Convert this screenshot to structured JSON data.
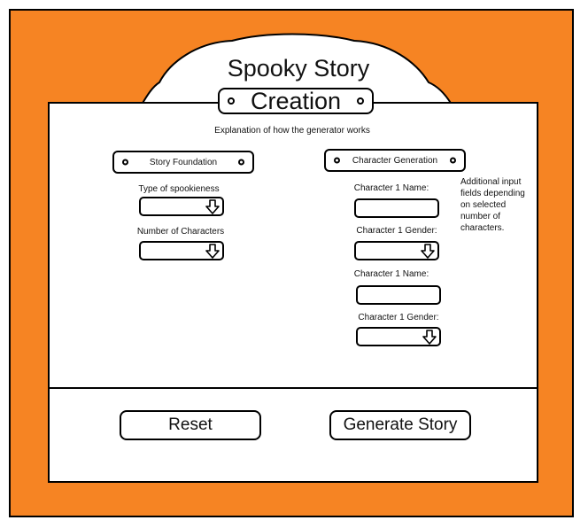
{
  "header": {
    "title_line1": "Spooky Story",
    "title_line2": "Creation"
  },
  "explanation": "Explanation of how the generator works",
  "story_foundation": {
    "heading": "Story Foundation",
    "fields": [
      {
        "label": "Type of spookieness",
        "value": ""
      },
      {
        "label": "Number of Characters",
        "value": ""
      }
    ]
  },
  "character_generation": {
    "heading": "Character Generation",
    "fields": [
      {
        "label": "Character 1 Name:",
        "type": "text",
        "value": ""
      },
      {
        "label": "Character 1 Gender:",
        "type": "dropdown",
        "value": ""
      },
      {
        "label": "Character 1 Name:",
        "type": "text",
        "value": ""
      },
      {
        "label": "Character 1 Gender:",
        "type": "dropdown",
        "value": ""
      }
    ],
    "note": "Additional input fields depending on selected number of characters."
  },
  "buttons": {
    "reset": "Reset",
    "generate": "Generate Story"
  },
  "colors": {
    "frame": "#f68423",
    "panel": "#ffffff",
    "outline": "#000000"
  },
  "icons": {
    "dropdown": "down-arrow-icon",
    "plaque": "screw-icon"
  }
}
